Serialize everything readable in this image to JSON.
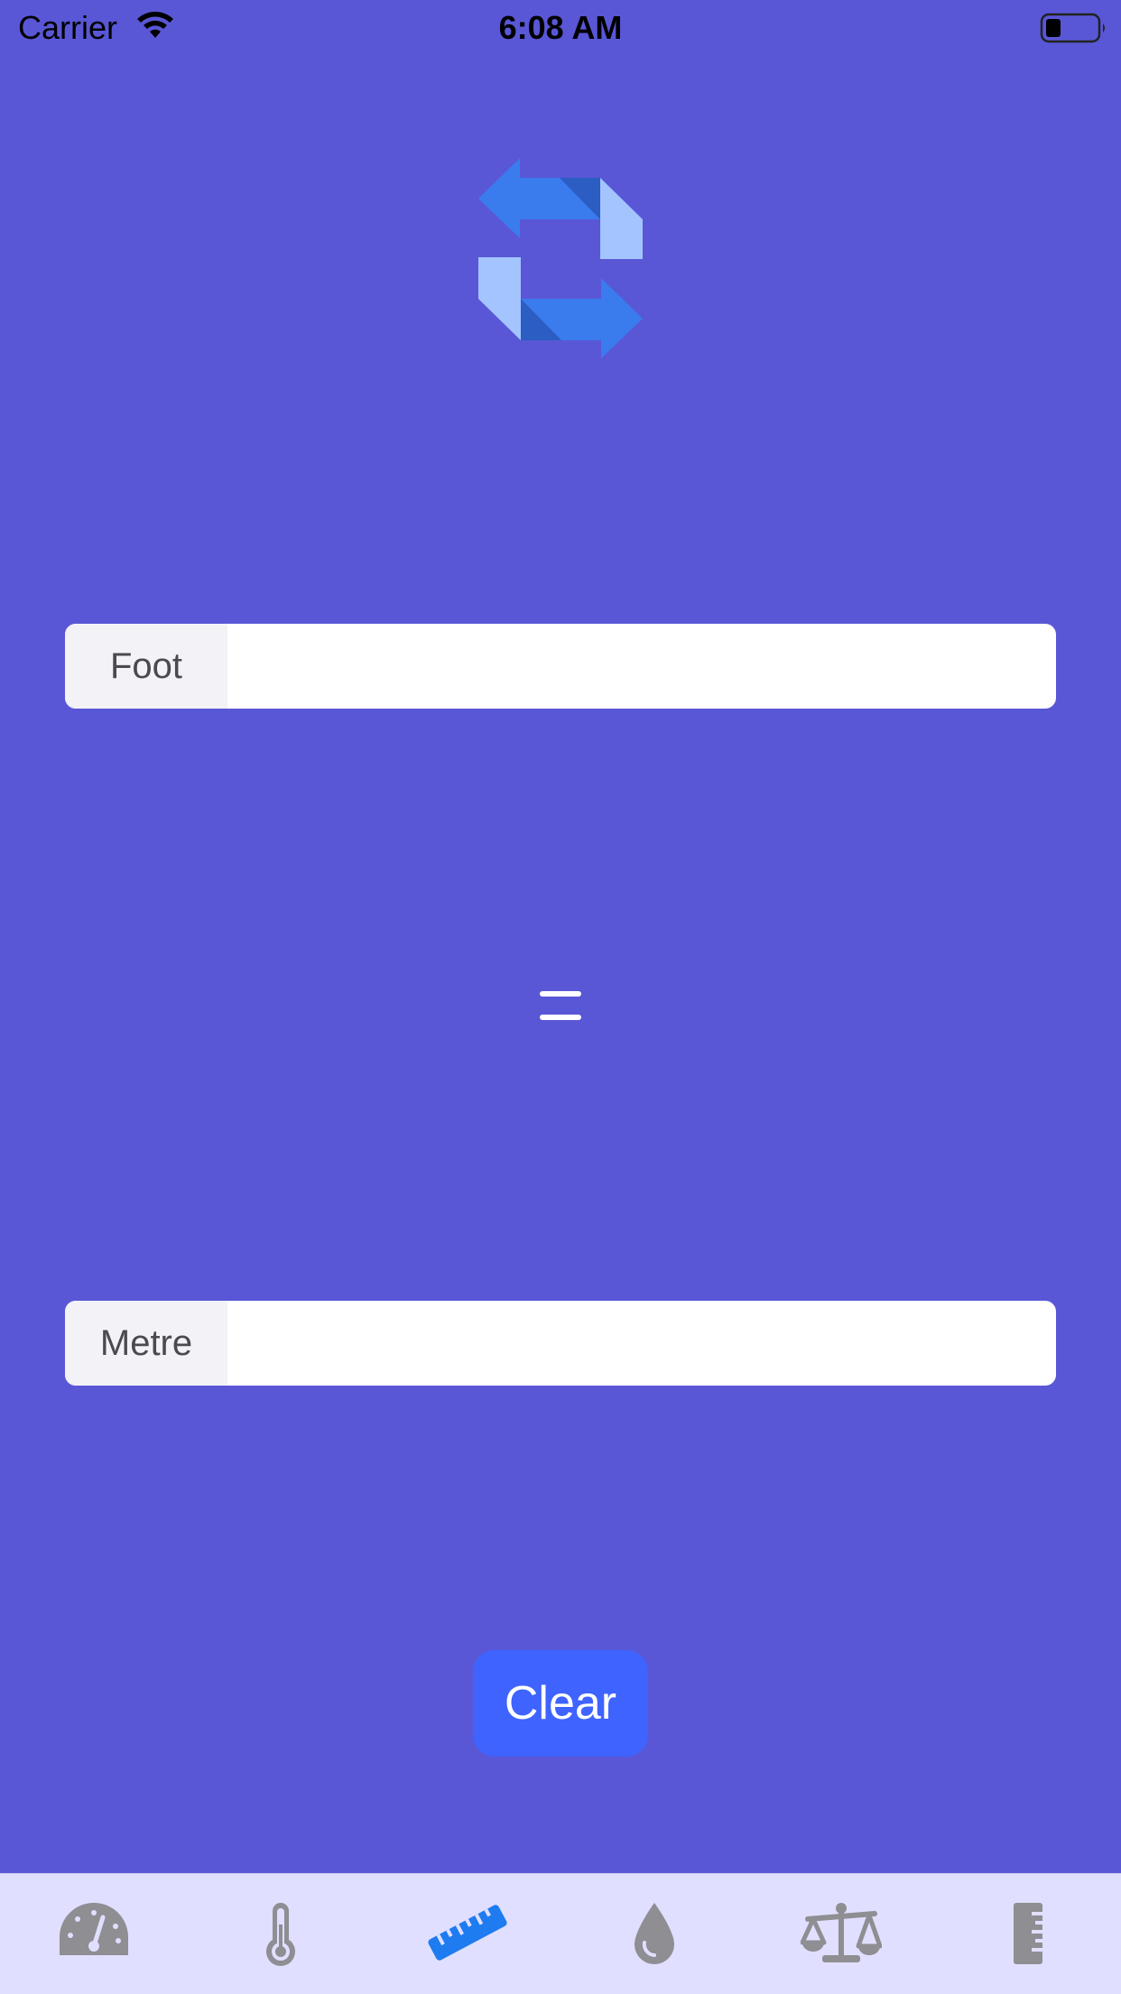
{
  "status_bar": {
    "carrier": "Carrier",
    "time": "6:08 AM"
  },
  "converter": {
    "from_unit_label": "Foot",
    "from_value": "",
    "to_unit_label": "Metre",
    "to_value": "",
    "equals_symbol": "=",
    "clear_label": "Clear"
  },
  "tab_bar": {
    "items": [
      {
        "icon": "speedometer-icon",
        "selected": false
      },
      {
        "icon": "thermometer-icon",
        "selected": false
      },
      {
        "icon": "ruler-icon",
        "selected": true
      },
      {
        "icon": "water-drop-icon",
        "selected": false
      },
      {
        "icon": "scale-icon",
        "selected": false
      },
      {
        "icon": "vertical-ruler-icon",
        "selected": false
      }
    ]
  },
  "colors": {
    "background": "#5957D6",
    "tab_bar_background": "#E0DFFF",
    "tab_selected": "#1E7BF0",
    "tab_unselected": "#8E8E93",
    "clear_button": "#3E63FF"
  }
}
